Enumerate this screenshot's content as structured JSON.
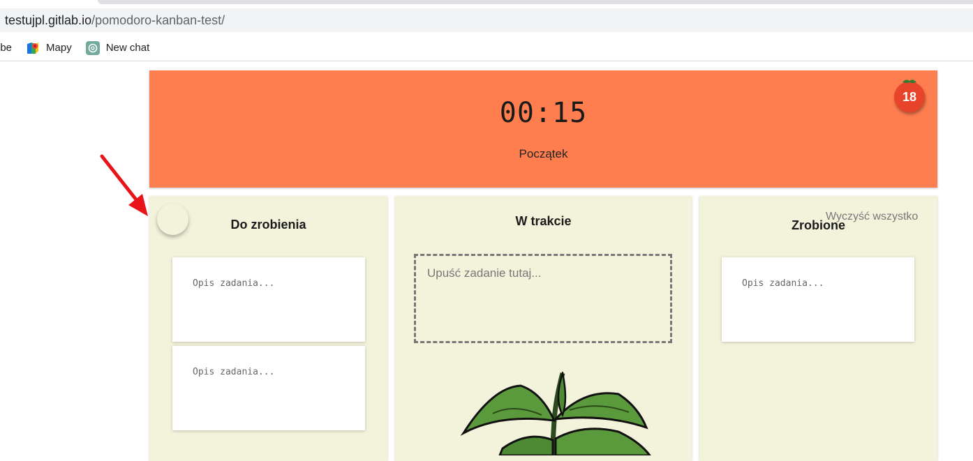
{
  "browser": {
    "url_host": "testujpl.gitlab.io",
    "url_path": "/pomodoro-kanban-test/",
    "bookmarks": [
      "ube",
      "Mapy",
      "New chat"
    ]
  },
  "timer": {
    "value": "00:15",
    "start_label": "Początek",
    "pomodoro_count": "18"
  },
  "columns": {
    "todo": {
      "title": "Do zrobienia",
      "cards": [
        "Opis zadania...",
        "Opis zadania..."
      ]
    },
    "in_progress": {
      "title": "W trakcie",
      "dropzone_placeholder": "Upuść zadanie tutaj..."
    },
    "done": {
      "title": "Zrobione",
      "clear_label": "Wyczyść wszystko",
      "cards": [
        "Opis zadania..."
      ]
    }
  },
  "colors": {
    "timer_bg": "#ff7e4f",
    "column_bg": "#f3f3dc",
    "tomato": "#e8442c",
    "annotation_arrow": "#e8141a"
  }
}
